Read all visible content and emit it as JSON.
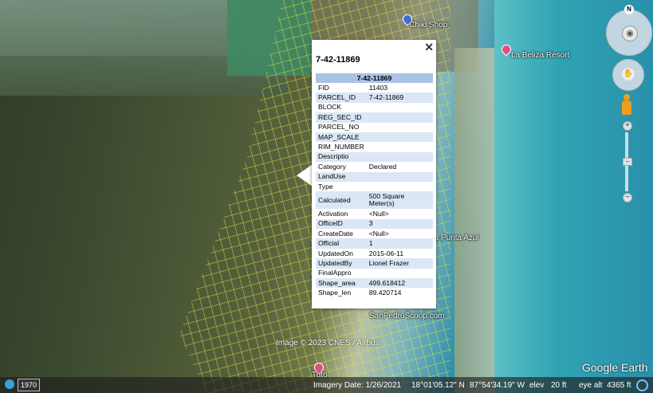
{
  "map": {
    "labels": {
      "chiki_shop": "Chiki Shop",
      "la_beliza_resort": "La Beliza Resort",
      "la_punta_azul": "La Punta Azul",
      "sanpedroscoop": "SanPedroScoop.com",
      "tuto": "Tuto"
    },
    "copyright": "Image © 2023 CNES / Airbus",
    "brand": "Google Earth"
  },
  "popup": {
    "title": "7-42-11869",
    "table_header": "7-42-11869",
    "close_glyph": "✕",
    "rows": [
      {
        "key": "FID",
        "value": "11403"
      },
      {
        "key": "PARCEL_ID",
        "value": "7-42-11869"
      },
      {
        "key": "BLOCK",
        "value": ""
      },
      {
        "key": "REG_SEC_ID",
        "value": ""
      },
      {
        "key": "PARCEL_NO",
        "value": ""
      },
      {
        "key": "MAP_SCALE",
        "value": ""
      },
      {
        "key": "RIM_NUMBER",
        "value": ""
      },
      {
        "key": "Descriptio",
        "value": ""
      },
      {
        "key": "Category",
        "value": "Declared"
      },
      {
        "key": "LandUse",
        "value": ""
      },
      {
        "key": "Type",
        "value": ""
      },
      {
        "key": "Calculated",
        "value": "500 Square Meter(s)"
      },
      {
        "key": "Activation",
        "value": "<Null>"
      },
      {
        "key": "OfficeID",
        "value": "3"
      },
      {
        "key": "CreateDate",
        "value": "<Null>"
      },
      {
        "key": "Official",
        "value": "1"
      },
      {
        "key": "UpdatedOn",
        "value": "2015-06-11"
      },
      {
        "key": "UpdatedBy",
        "value": "Lionel Frazer"
      },
      {
        "key": "FinalAppro",
        "value": ""
      },
      {
        "key": "Shape_area",
        "value": "499.618412"
      },
      {
        "key": "Shape_len",
        "value": "89.420714"
      }
    ]
  },
  "controls": {
    "north": "N"
  },
  "statusbar": {
    "year": "1970",
    "imagery_date": "Imagery Date: 1/26/2021",
    "lat": "18°01'05.12\" N",
    "lon": "87°54'34.19\" W",
    "elev_label": "elev",
    "elev_value": "20 ft",
    "eye_alt_label": "eye alt",
    "eye_alt_value": "4365 ft"
  }
}
